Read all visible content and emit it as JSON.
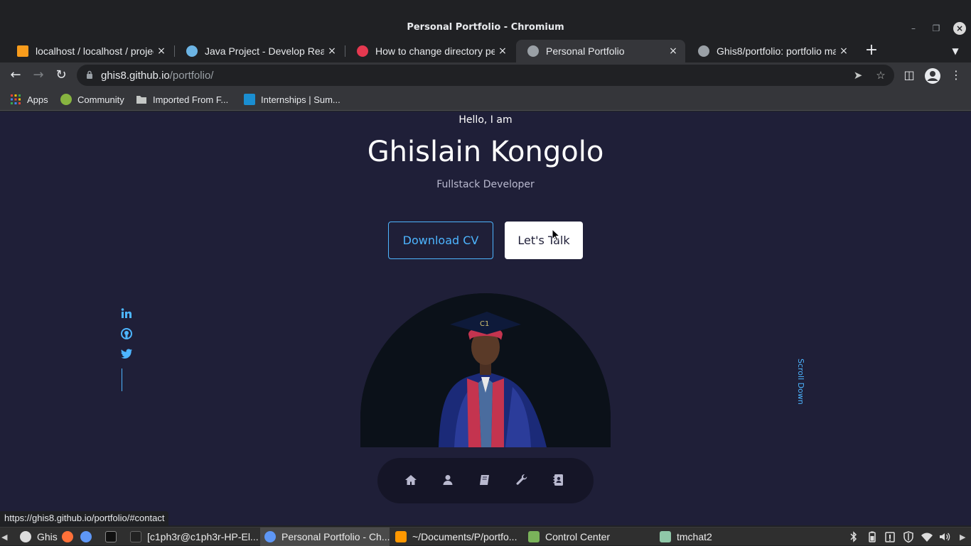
{
  "window": {
    "title": "Personal Portfolio - Chromium",
    "minimize_icon": "minimize-icon",
    "maximize_icon": "maximize-icon",
    "close_icon": "close-icon"
  },
  "tabs": [
    {
      "label": "localhost / localhost / projects",
      "favicon": "phpmyadmin-icon",
      "color": "#f89c1c",
      "active": false
    },
    {
      "label": "Java Project - Develop Real-time",
      "favicon": "java-icon",
      "color": "#6cb4e4",
      "active": false
    },
    {
      "label": "How to change directory permissions",
      "favicon": "video-icon",
      "color": "#e53950",
      "active": false
    },
    {
      "label": "Personal Portfolio",
      "favicon": "globe-icon",
      "color": "#9aa0a6",
      "active": true
    },
    {
      "label": "Ghis8/portfolio: portfolio made",
      "favicon": "github-icon",
      "color": "#9aa0a6",
      "active": false
    }
  ],
  "toolbar": {
    "url_host": "ghis8.github.io",
    "url_path": "/portfolio/"
  },
  "bookmarks": [
    {
      "label": "Apps",
      "icon": "apps-grid-icon"
    },
    {
      "label": "Community",
      "icon": "community-icon"
    },
    {
      "label": "Imported From F...",
      "icon": "folder-icon"
    },
    {
      "label": "Internships | Sum...",
      "icon": "internshala-icon"
    }
  ],
  "hero": {
    "greeting": "Hello, I am",
    "name": "Ghislain Kongolo",
    "role": "Fullstack Developer",
    "cv_button": "Download CV",
    "talk_button": "Let's Talk",
    "scroll_label": "Scroll Down"
  },
  "socials": [
    "linkedin-icon",
    "github-icon",
    "twitter-icon"
  ],
  "page_nav": [
    "home-icon",
    "user-icon",
    "book-icon",
    "wrench-icon",
    "contact-book-icon"
  ],
  "status_url": "https://ghis8.github.io/portfolio/#contact",
  "taskbar": [
    {
      "label": "Ghis",
      "icon": "user-switch-icon"
    },
    {
      "label": "",
      "icon": "firefox-icon"
    },
    {
      "label": "",
      "icon": "chromium-icon"
    },
    {
      "label": "",
      "icon": "terminal-icon"
    },
    {
      "label": "[c1ph3r@c1ph3r-HP-El...",
      "icon": "terminal-window-icon"
    },
    {
      "label": "Personal Portfolio - Ch...",
      "icon": "chromium-icon"
    },
    {
      "label": "~/Documents/P/portfo...",
      "icon": "sublime-icon"
    },
    {
      "label": "Control Center",
      "icon": "control-center-icon"
    },
    {
      "label": "tmchat2",
      "icon": "folder-icon"
    }
  ],
  "colors": {
    "page_bg": "#1f1f38",
    "accent": "#4db5ff",
    "chrome_dark": "#202124",
    "chrome_toolbar": "#35363a"
  }
}
